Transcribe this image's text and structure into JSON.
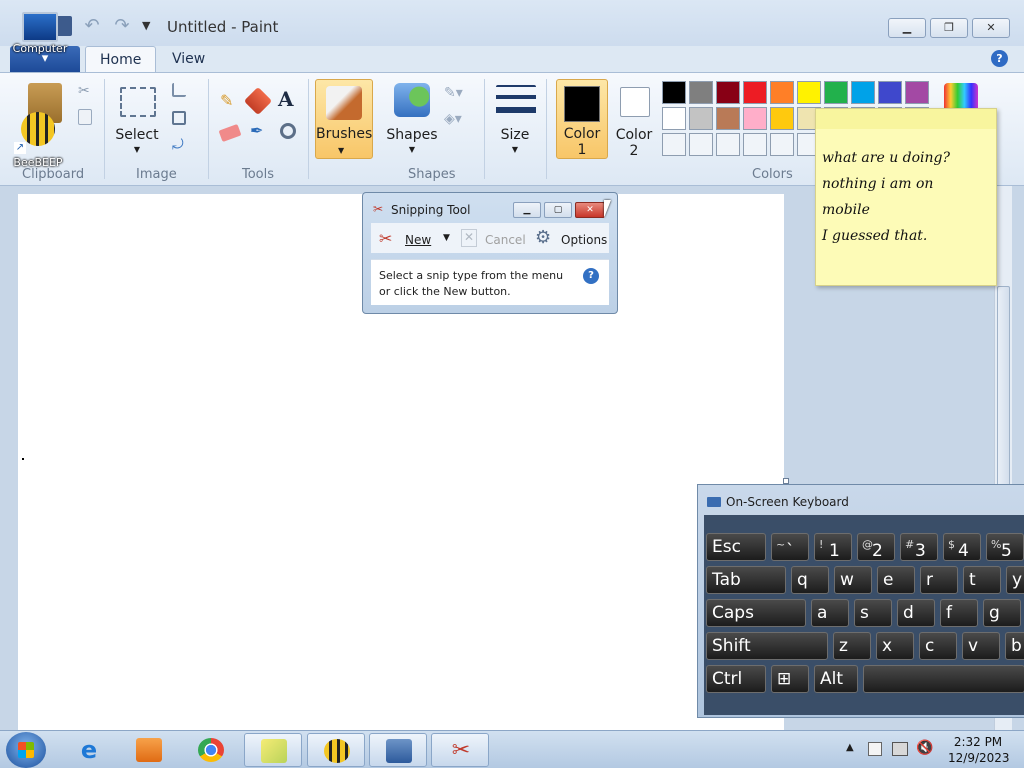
{
  "paint": {
    "title": "Untitled - Paint",
    "tabs": {
      "home": "Home",
      "view": "View"
    },
    "buttons": {
      "select": "Select",
      "brushes": "Brushes",
      "shapes": "Shapes",
      "size": "Size",
      "color1": "Color\n1",
      "color2": "Color\n2"
    },
    "groups": {
      "clipboard": "Clipboard",
      "image": "Image",
      "tools": "Tools",
      "shapes": "Shapes",
      "colors": "Colors"
    },
    "palette": [
      "#000000",
      "#7f7f7f",
      "#880015",
      "#ed1c24",
      "#ff7f27",
      "#fff200",
      "#22b14c",
      "#00a2e8",
      "#3f48cc",
      "#a349a4",
      "#ffffff",
      "#c3c3c3",
      "#b97a57",
      "#ffaec9",
      "#ffc90e",
      "#efe4b0",
      "#b5e61d",
      "#99d9ea",
      "#7092be",
      "#c8bfe7",
      "#f0f4f9",
      "#f0f4f9",
      "#f0f4f9",
      "#f0f4f9",
      "#f0f4f9",
      "#f0f4f9",
      "#f0f4f9",
      "#f0f4f9",
      "#f0f4f9",
      "#f0f4f9"
    ],
    "color1_value": "#000000",
    "color2_value": "#ffffff"
  },
  "desktop": {
    "computer_label": "Computer",
    "beebeep_label": "BeeBEEP"
  },
  "snipping_tool": {
    "title": "Snipping Tool",
    "new_label": "New",
    "cancel_label": "Cancel",
    "options_label": "Options",
    "message": "Select a snip type from the menu\nor click the New button."
  },
  "sticky_note": {
    "text": "what are u doing?\nnothing  i am on\nmobile\nI guessed that."
  },
  "keyboard": {
    "title": "On-Screen Keyboard",
    "rows": [
      [
        "Esc",
        "~ `",
        "! 1",
        "@ 2",
        "# 3",
        "$ 4",
        "% 5"
      ],
      [
        "Tab",
        "q",
        "w",
        "e",
        "r",
        "t",
        "y"
      ],
      [
        "Caps",
        "a",
        "s",
        "d",
        "f",
        "g"
      ],
      [
        "Shift",
        "z",
        "x",
        "c",
        "v",
        "b"
      ],
      [
        "Ctrl",
        "⊞",
        "Alt"
      ]
    ]
  },
  "taskbar": {
    "time": "2:32 PM",
    "date": "12/9/2023"
  }
}
